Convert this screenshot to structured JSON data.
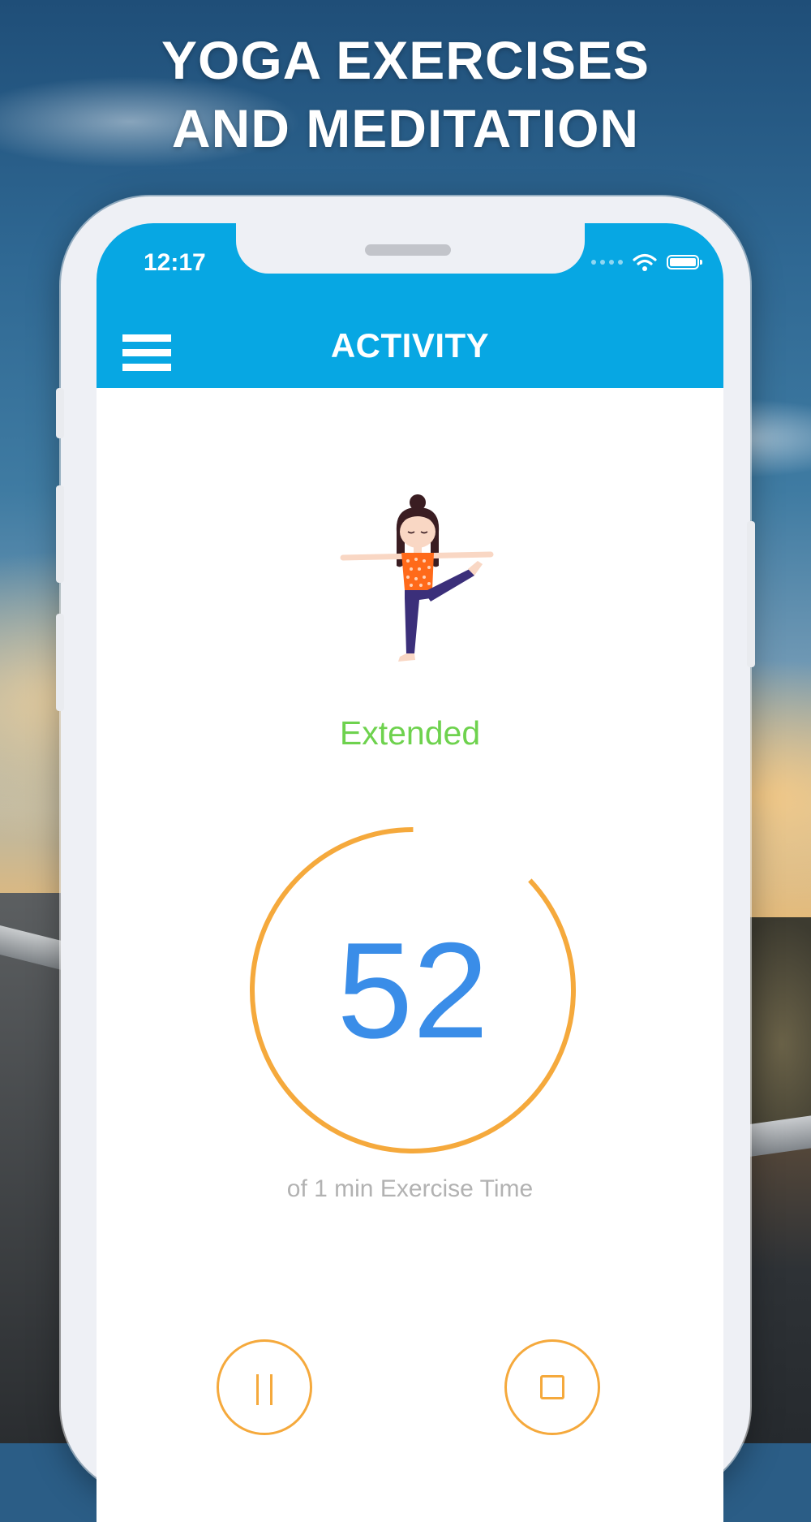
{
  "promo": {
    "line1": "YOGA EXERCISES",
    "line2": "AND MEDITATION"
  },
  "status_bar": {
    "time": "12:17",
    "icons": [
      "signal-dots-icon",
      "wifi-icon",
      "battery-icon"
    ]
  },
  "header": {
    "title": "ACTIVITY",
    "menu_icon": "hamburger-menu-icon",
    "color": "#07a7e3"
  },
  "exercise": {
    "pose_name": "Extended",
    "pose_name_color": "#6ed24e",
    "illustration": "yoga-pose-illustration"
  },
  "timer": {
    "seconds_remaining": "52",
    "caption": "of 1 min Exercise Time",
    "progress_fraction": 0.87,
    "ring_color": "#f5a93c",
    "value_color": "#3a8de8"
  },
  "controls": {
    "pause_icon": "pause-icon",
    "stop_icon": "stop-icon"
  }
}
